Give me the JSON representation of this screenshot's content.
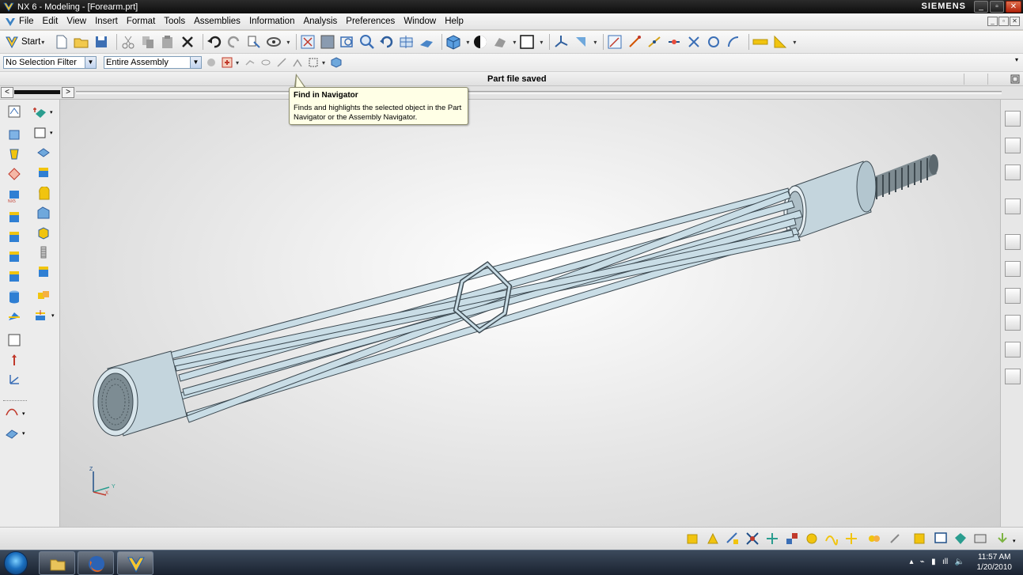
{
  "window": {
    "title": "NX 6 - Modeling - [Forearm.prt]",
    "brand": "SIEMENS"
  },
  "menu": {
    "items": [
      "File",
      "Edit",
      "View",
      "Insert",
      "Format",
      "Tools",
      "Assemblies",
      "Information",
      "Analysis",
      "Preferences",
      "Window",
      "Help"
    ]
  },
  "toolbar": {
    "start_label": "Start"
  },
  "selection": {
    "filter_value": "No Selection Filter",
    "scope_value": "Entire Assembly"
  },
  "status": {
    "message": "Part file saved"
  },
  "tooltip": {
    "title": "Find in Navigator",
    "body": "Finds and highlights the selected object in the Part Navigator or the Assembly Navigator."
  },
  "triad": {
    "z": "Z",
    "y": "Y",
    "x": "X"
  },
  "taskbar": {
    "time": "11:57 AM",
    "date": "1/20/2010"
  },
  "colors": {
    "part_fill": "#c9dde6",
    "part_edge": "#3d4a52",
    "viewport_bg": "#dedede",
    "tooltip_bg": "#ffffe6"
  }
}
